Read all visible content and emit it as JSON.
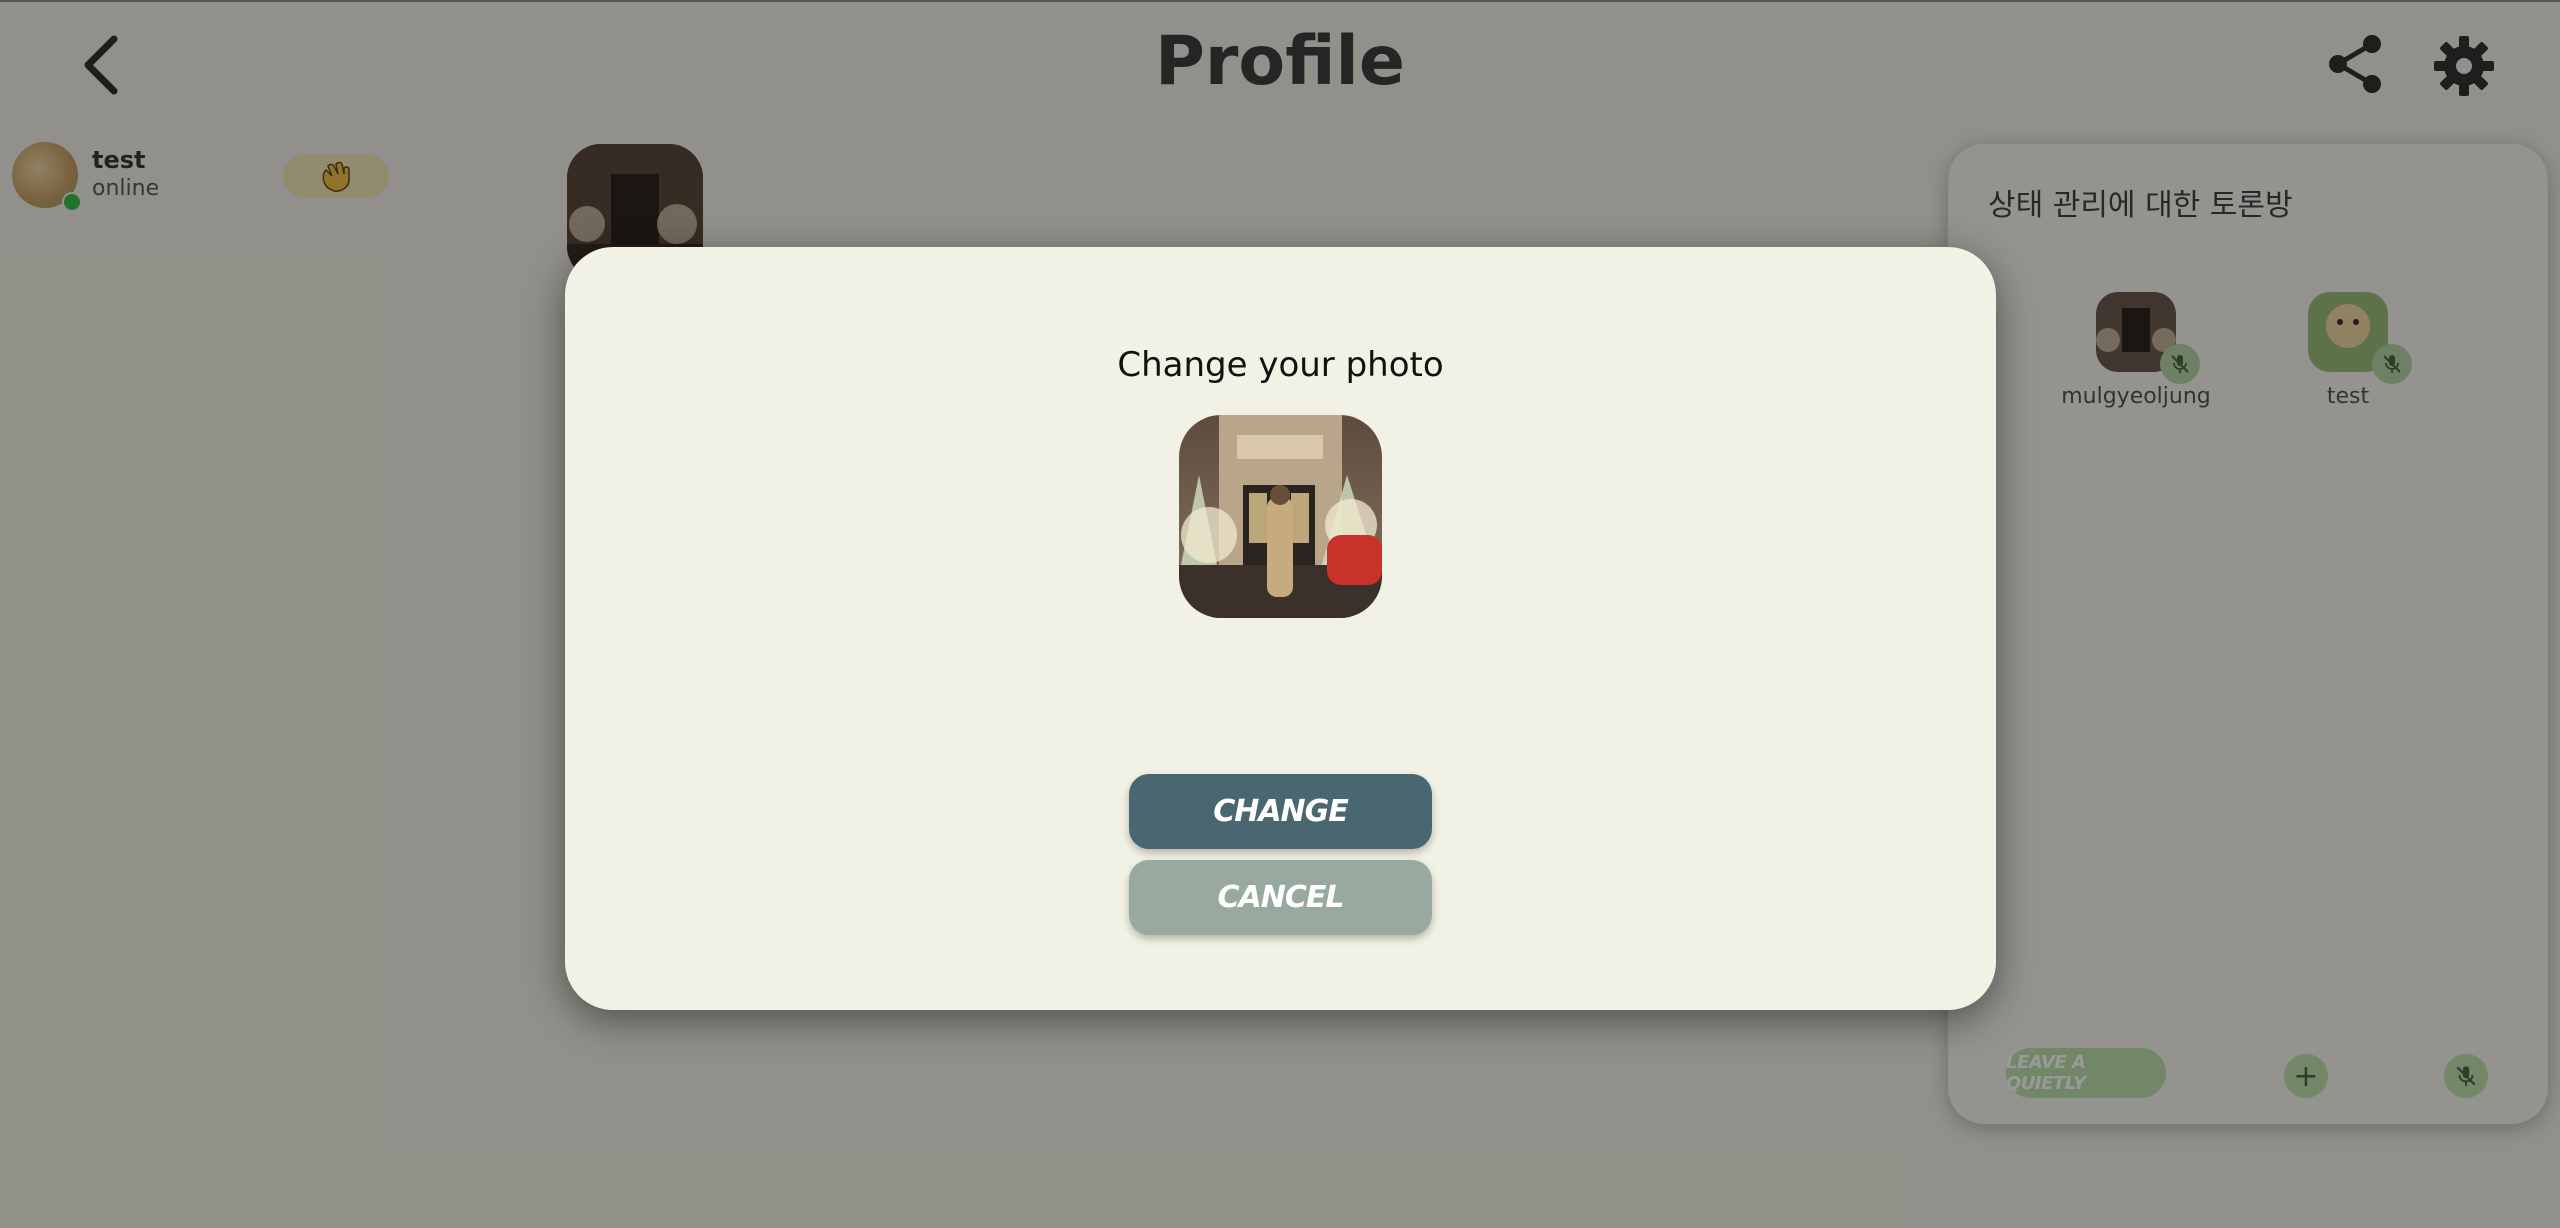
{
  "header": {
    "title": "Profile",
    "back_icon": "chevron-left-icon",
    "share_icon": "share-icon",
    "settings_icon": "gear-icon"
  },
  "user": {
    "name": "test",
    "status": "online",
    "wave_icon": "waving-hand-icon"
  },
  "room": {
    "title": "상태 관리에 대한 토론방",
    "members": [
      {
        "name": "mulgyeoljung",
        "mic_icon": "mic-off-icon"
      },
      {
        "name": "test",
        "mic_icon": "mic-off-icon"
      }
    ],
    "leave_label": "LEAVE A QUIETLY",
    "add_icon": "plus-icon",
    "mic_icon": "mic-off-icon"
  },
  "modal": {
    "title": "Change your photo",
    "change_label": "CHANGE",
    "cancel_label": "CANCEL"
  },
  "colors": {
    "change_button": "#4a6670",
    "cancel_button": "#98aaa0",
    "background": "#f2f1e6",
    "online": "#3bbf4a",
    "room_accent": "#bfe0ad"
  }
}
